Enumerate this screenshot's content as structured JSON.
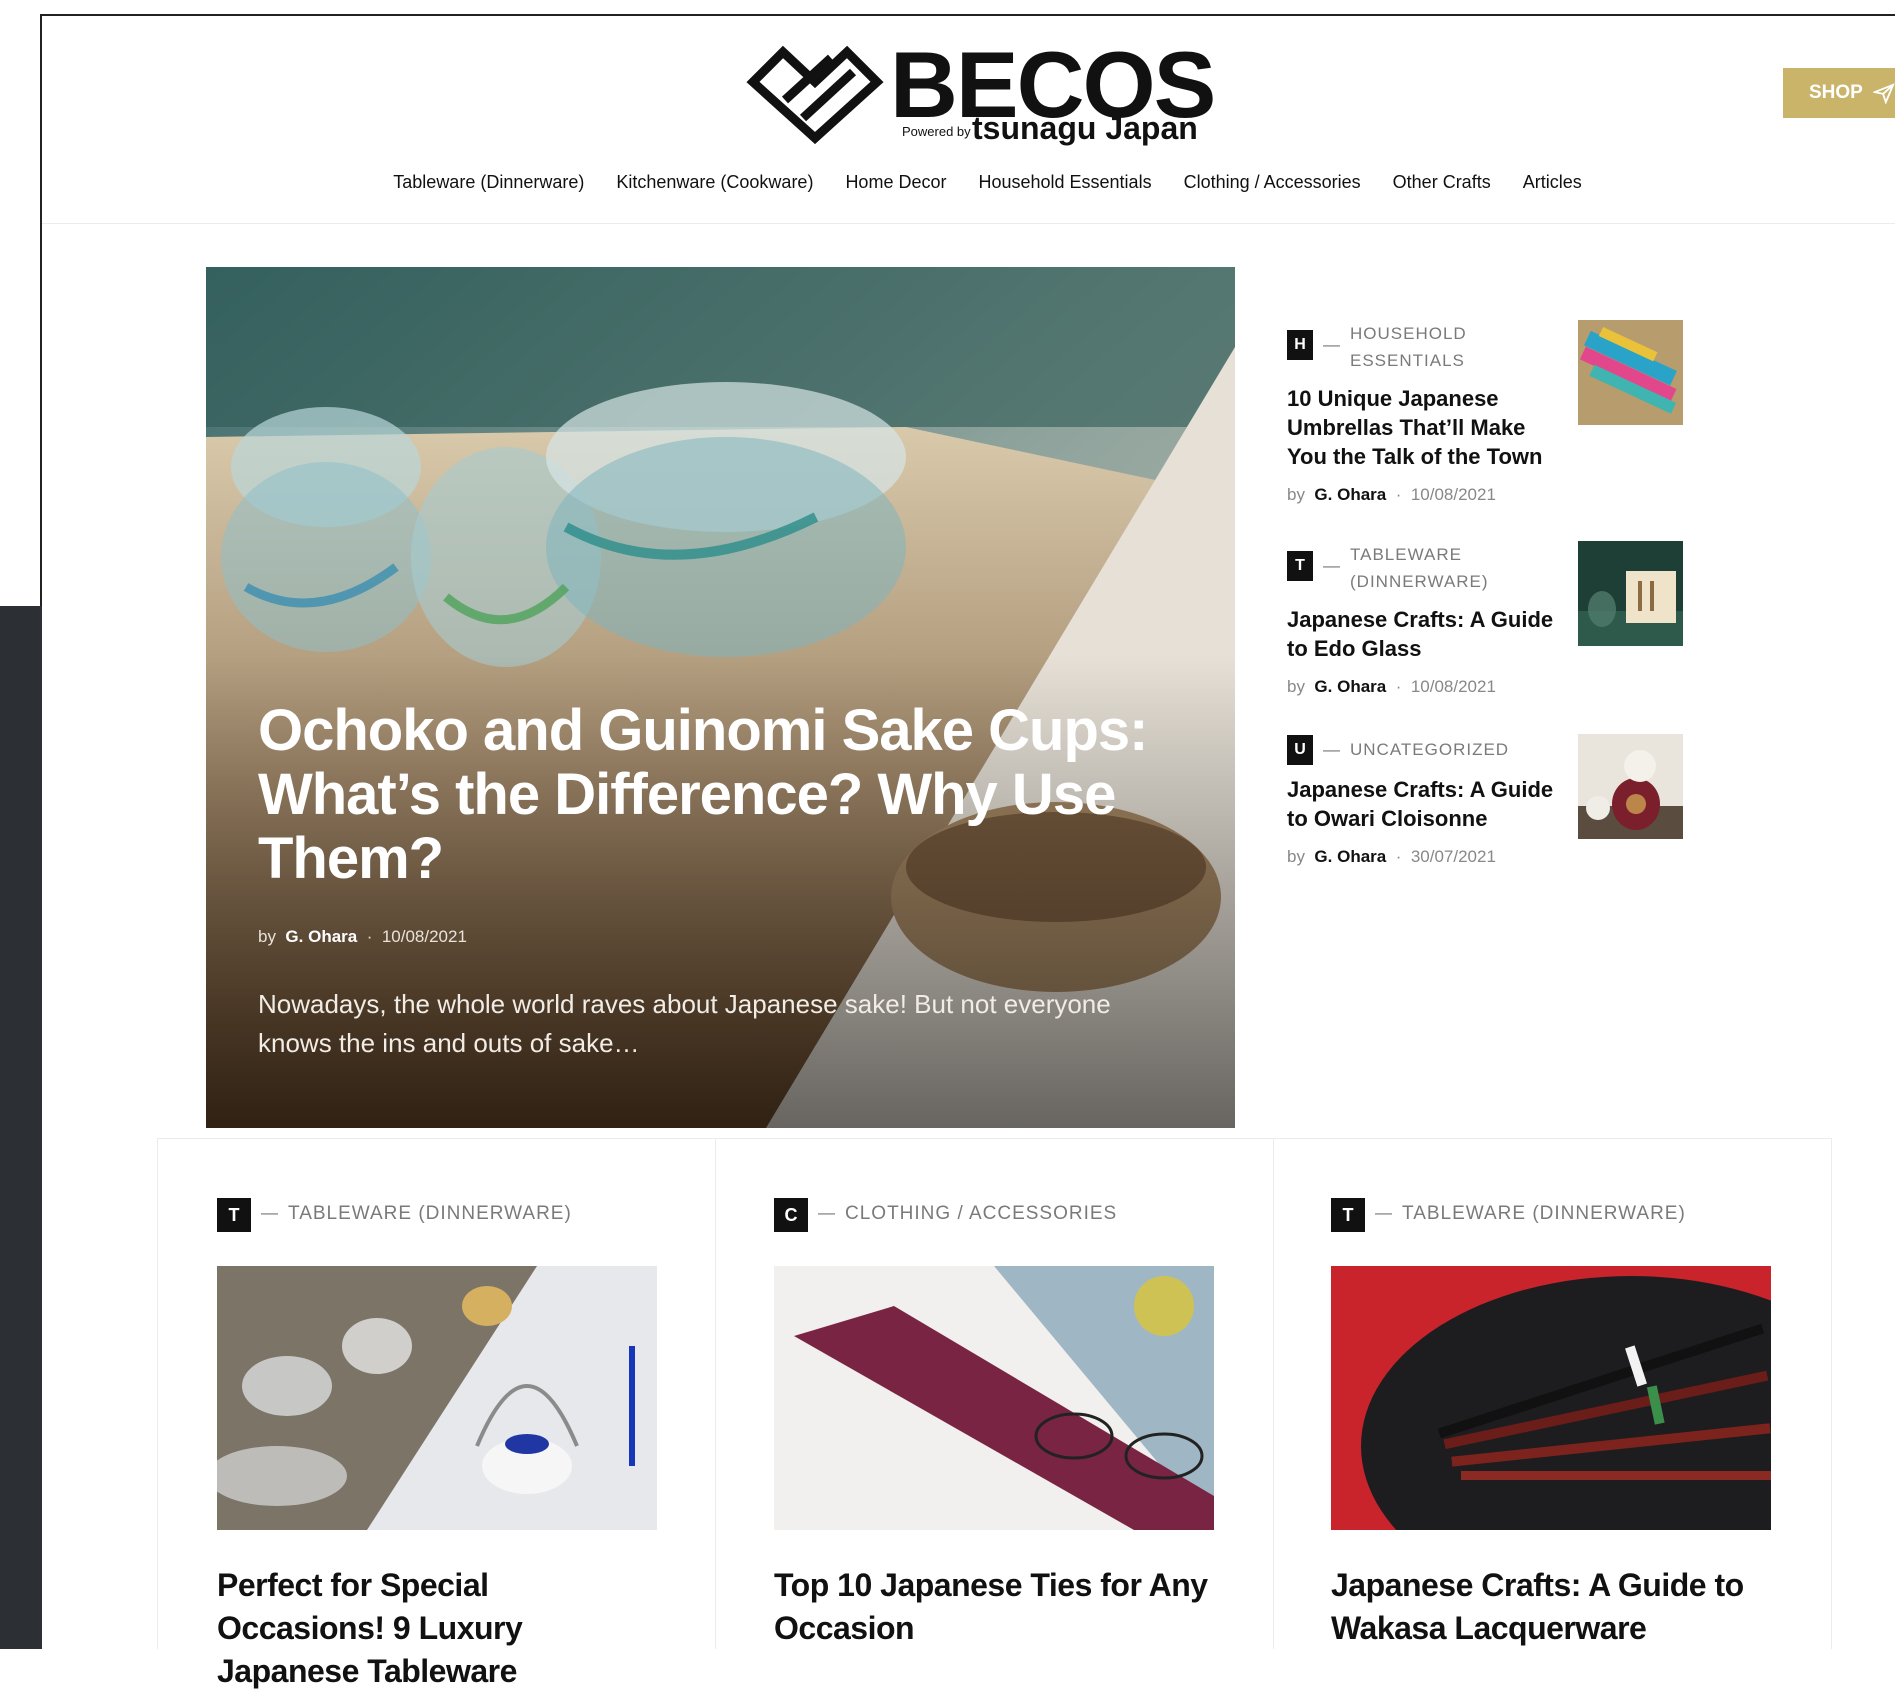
{
  "brand": {
    "name": "BECOS",
    "powered_by": "Powered by",
    "sub": "tsunagu Japan"
  },
  "shop_button": "SHOP",
  "nav": [
    "Tableware (Dinnerware)",
    "Kitchenware (Cookware)",
    "Home Decor",
    "Household Essentials",
    "Clothing / Accessories",
    "Other Crafts",
    "Articles"
  ],
  "hero": {
    "title": "Ochoko and Guinomi Sake Cups: What’s the Difference? Why Use Them?",
    "by": "by",
    "author": "G. Ohara",
    "sep": "·",
    "date": "10/08/2021",
    "excerpt": "Nowadays, the whole world raves about Japanese sake! But not everyone knows the ins and outs of sake…"
  },
  "side": [
    {
      "badge": "H",
      "category": "HOUSEHOLD ESSENTIALS",
      "title": "10 Unique Japanese Umbrellas That’ll Make You the Talk of the Town",
      "by": "by",
      "author": "G. Ohara",
      "sep": "·",
      "date": "10/08/2021"
    },
    {
      "badge": "T",
      "category": "TABLEWARE (DINNERWARE)",
      "title": "Japanese Crafts: A Guide to Edo Glass",
      "by": "by",
      "author": "G. Ohara",
      "sep": "·",
      "date": "10/08/2021"
    },
    {
      "badge": "U",
      "category": "UNCATEGORIZED",
      "title": "Japanese Crafts: A Guide to Owari Cloisonne",
      "by": "by",
      "author": "G. Ohara",
      "sep": "·",
      "date": "30/07/2021"
    }
  ],
  "cards": [
    {
      "badge": "T",
      "category": "TABLEWARE (DINNERWARE)",
      "title": "Perfect for Special Occasions! 9 Luxury Japanese Tableware"
    },
    {
      "badge": "C",
      "category": "CLOTHING / ACCESSORIES",
      "title": "Top 10 Japanese Ties for Any Occasion"
    },
    {
      "badge": "T",
      "category": "TABLEWARE (DINNERWARE)",
      "title": "Japanese Crafts: A Guide to Wakasa Lacquerware"
    }
  ],
  "dash": "—",
  "colors": {
    "shop": "#c9b46a",
    "badge": "#111111",
    "sidebar_dark": "#2c2f33"
  }
}
